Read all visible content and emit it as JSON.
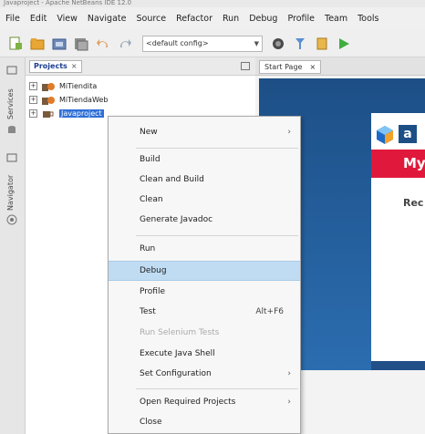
{
  "window": {
    "title": "Javaproject - Apache NetBeans IDE 12.0"
  },
  "menubar": [
    "File",
    "Edit",
    "View",
    "Navigate",
    "Source",
    "Refactor",
    "Run",
    "Debug",
    "Profile",
    "Team",
    "Tools"
  ],
  "toolbar": {
    "config_value": "<default config>"
  },
  "sidestrip": {
    "services_label": "Services",
    "navigator_label": "Navigator"
  },
  "projects_panel": {
    "tab_label": "Projects",
    "tab_close": "×",
    "items": [
      {
        "label": "MiTiendita",
        "expander": "+"
      },
      {
        "label": "MiTiendaWeb",
        "expander": "+"
      },
      {
        "label": "Javaproject",
        "expander": "+"
      }
    ]
  },
  "editor": {
    "tab_label": "Start Page",
    "tab_close": "×"
  },
  "startpage": {
    "logo_text": "a",
    "banner_text": "My",
    "recent_text": "Rec"
  },
  "context_menu": {
    "items": [
      {
        "label": "New",
        "submenu": true
      },
      {
        "label": "Build"
      },
      {
        "label": "Clean and Build"
      },
      {
        "label": "Clean"
      },
      {
        "label": "Generate Javadoc"
      },
      {
        "label": "Run"
      },
      {
        "label": "Debug",
        "highlighted": true
      },
      {
        "label": "Profile"
      },
      {
        "label": "Test",
        "accel": "Alt+F6"
      },
      {
        "label": "Run Selenium Tests",
        "disabled": true
      },
      {
        "label": "Execute Java Shell"
      },
      {
        "label": "Set Configuration",
        "submenu": true
      },
      {
        "label": "Open Required Projects",
        "submenu": true
      },
      {
        "label": "Close"
      }
    ],
    "submenu_arrow": "›"
  },
  "colors": {
    "selection": "#2f6fd6",
    "menu_highlight": "#c0dcf3",
    "banner_red": "#e0193c",
    "startpage_blue": "#1d4f86"
  }
}
